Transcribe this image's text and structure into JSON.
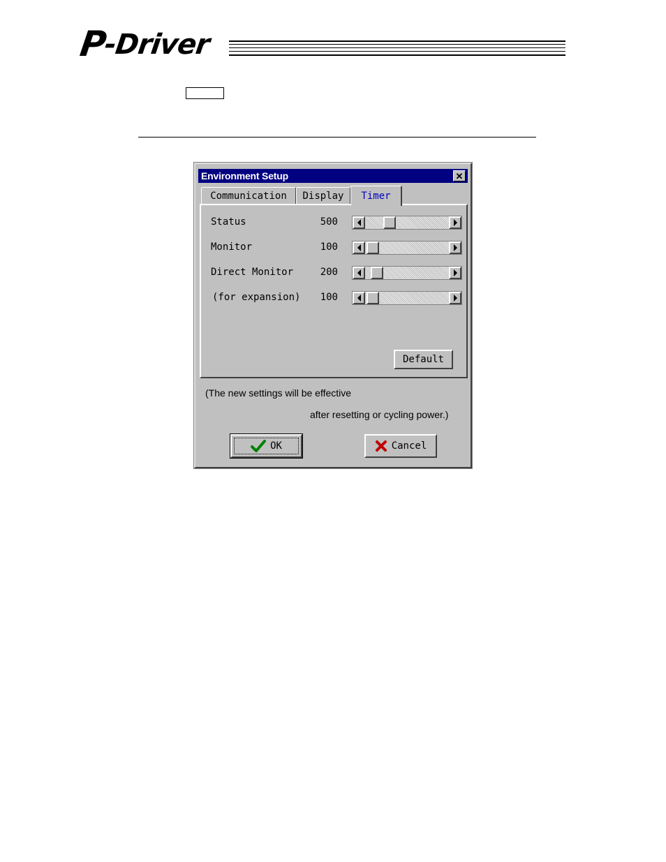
{
  "header": {
    "logo_p": "P",
    "logo_rest": "-Driver"
  },
  "dialog": {
    "title": "Environment Setup",
    "close_glyph": "✕",
    "tabs": [
      {
        "label": "Communication",
        "active": false
      },
      {
        "label": "Display",
        "active": false
      },
      {
        "label": "Timer",
        "active": true
      }
    ],
    "timer_rows": [
      {
        "label": "Status",
        "value": "500",
        "slider_fraction": 0.25
      },
      {
        "label": "Monitor",
        "value": "100",
        "slider_fraction": 0.02
      },
      {
        "label": "Direct Monitor",
        "value": "200",
        "slider_fraction": 0.08
      },
      {
        "label": "(for expansion)",
        "value": "100",
        "slider_fraction": 0.02
      }
    ],
    "default_button": "Default",
    "note_line1": "(The new settings will be effective",
    "note_line2": "after resetting or cycling power.)",
    "ok_button": "OK",
    "cancel_button": "Cancel"
  },
  "icons": {
    "close": "close-icon",
    "ok": "checkmark-icon",
    "cancel": "x-icon",
    "scroll_left": "arrow-left-icon",
    "scroll_right": "arrow-right-icon"
  },
  "colors": {
    "titlebar": "#000080",
    "active_tab_text": "#0000c0",
    "ok_check": "#008000",
    "cancel_x": "#c00000",
    "dialog_face": "#c0c0c0"
  }
}
